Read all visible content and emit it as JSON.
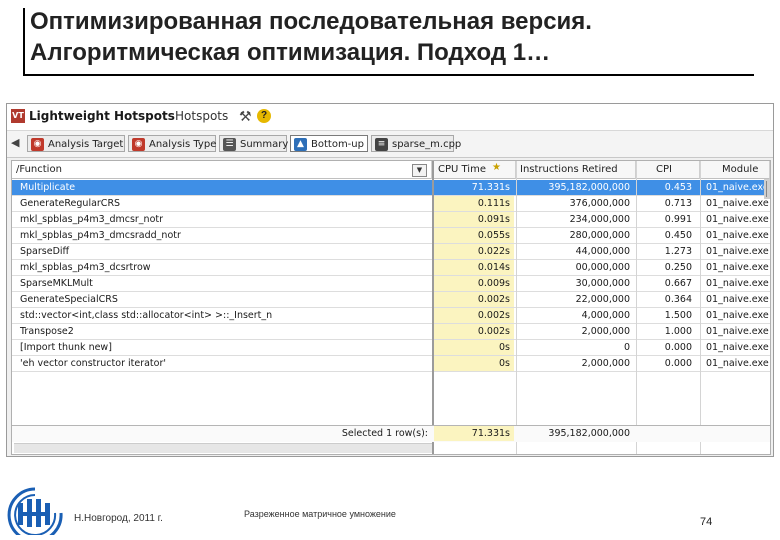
{
  "slide": {
    "title_line1": "Оптимизированная последовательная версия.",
    "title_line2": "Алгоритмическая оптимизация. Подход 1…",
    "footer_city": "Н.Новгород, 2011 г.",
    "footer_topic": "Разреженное матричное умножение",
    "page_number": "74"
  },
  "app": {
    "title": "Lightweight Hotspots",
    "subtitle": "Hotspots",
    "logo_text": "VT",
    "icons": {
      "logo": "vtune-logo-icon",
      "tools": "tools-icon",
      "help": "help-icon"
    }
  },
  "tabs": [
    {
      "label": "Analysis Target",
      "icon": "target-icon",
      "icon_color": "#c0392b",
      "active": false
    },
    {
      "label": "Analysis Type",
      "icon": "analysis-type-icon",
      "icon_color": "#c0392b",
      "active": false
    },
    {
      "label": "Summary",
      "icon": "summary-icon",
      "icon_color": "#555555",
      "active": false
    },
    {
      "label": "Bottom-up",
      "icon": "bottom-up-icon",
      "icon_color": "#2e6fb8",
      "active": true
    },
    {
      "label": "sparse_m.cpp",
      "icon": "source-file-icon",
      "icon_color": "#444444",
      "active": false
    }
  ],
  "grid": {
    "headers": {
      "function": "/Function",
      "cpu_time": "CPU Time",
      "instructions": "Instructions Retired",
      "cpi": "CPI",
      "module": "Module"
    },
    "rows": [
      {
        "function": "Multiplicate",
        "cpu": "71.331s",
        "instr": "395,182,000,000",
        "cpi": "0.453",
        "module": "01_naive.exe",
        "selected": true
      },
      {
        "function": "GenerateRegularCRS",
        "cpu": "0.111s",
        "instr": "376,000,000",
        "cpi": "0.713",
        "module": "01_naive.exe",
        "selected": false
      },
      {
        "function": "mkl_spblas_p4m3_dmcsr_notr",
        "cpu": "0.091s",
        "instr": "234,000,000",
        "cpi": "0.991",
        "module": "01_naive.exe",
        "selected": false
      },
      {
        "function": "mkl_spblas_p4m3_dmcsradd_notr",
        "cpu": "0.055s",
        "instr": "280,000,000",
        "cpi": "0.450",
        "module": "01_naive.exe",
        "selected": false
      },
      {
        "function": "SparseDiff",
        "cpu": "0.022s",
        "instr": "44,000,000",
        "cpi": "1.273",
        "module": "01_naive.exe",
        "selected": false
      },
      {
        "function": "mkl_spblas_p4m3_dcsrtrow",
        "cpu": "0.014s",
        "instr": "00,000,000",
        "cpi": "0.250",
        "module": "01_naive.exe",
        "selected": false
      },
      {
        "function": "SparseMKLMult",
        "cpu": "0.009s",
        "instr": "30,000,000",
        "cpi": "0.667",
        "module": "01_naive.exe",
        "selected": false
      },
      {
        "function": "GenerateSpecialCRS",
        "cpu": "0.002s",
        "instr": "22,000,000",
        "cpi": "0.364",
        "module": "01_naive.exe",
        "selected": false
      },
      {
        "function": "std::vector<int,class std::allocator<int> >::_Insert_n",
        "cpu": "0.002s",
        "instr": "4,000,000",
        "cpi": "1.500",
        "module": "01_naive.exe",
        "selected": false
      },
      {
        "function": "Transpose2",
        "cpu": "0.002s",
        "instr": "2,000,000",
        "cpi": "1.000",
        "module": "01_naive.exe",
        "selected": false
      },
      {
        "function": "[Import thunk new]",
        "cpu": "0s",
        "instr": "0",
        "cpi": "0.000",
        "module": "01_naive.exe",
        "selected": false
      },
      {
        "function": "'eh vector constructor iterator'",
        "cpu": "0s",
        "instr": "2,000,000",
        "cpi": "0.000",
        "module": "01_naive.exe",
        "selected": false
      }
    ],
    "total": {
      "label": "Selected 1 row(s):",
      "cpu": "71.331s",
      "instr": "395,182,000,000"
    },
    "icons": {
      "dropdown": "dropdown-arrow-icon",
      "star": "star-icon"
    }
  },
  "colors": {
    "selection": "#3f8fe6",
    "cpu_column_bg": "#fbf4c0",
    "logo_blue": "#1a5fb4"
  }
}
